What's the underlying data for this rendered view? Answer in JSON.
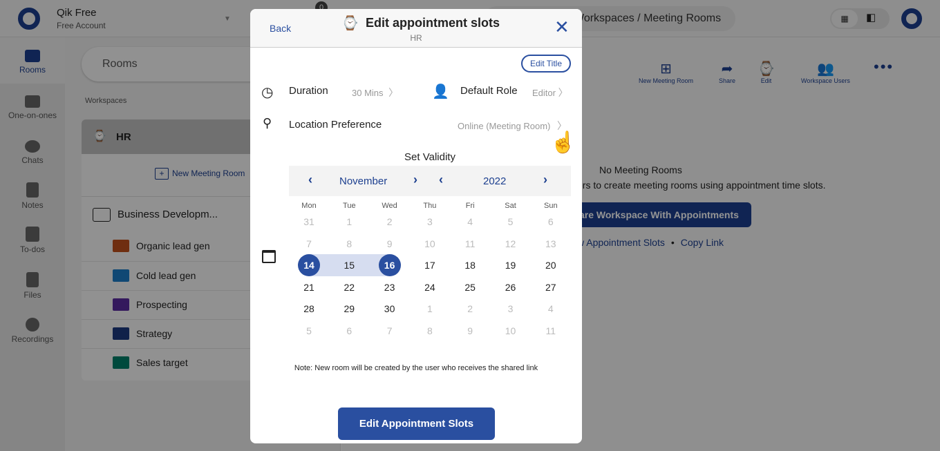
{
  "app": {
    "name": "Qik Free",
    "account": "Free Account",
    "badge": "0"
  },
  "breadcrumb": "Workspaces / Meeting Rooms",
  "sidebar": {
    "items": [
      {
        "label": "Rooms",
        "icon": "rooms-icon",
        "active": true
      },
      {
        "label": "One-on-ones",
        "icon": "people-icon"
      },
      {
        "label": "Chats",
        "icon": "chat-icon"
      },
      {
        "label": "Notes",
        "icon": "notes-icon"
      },
      {
        "label": "To-dos",
        "icon": "todo-icon"
      },
      {
        "label": "Files",
        "icon": "files-icon"
      },
      {
        "label": "Recordings",
        "icon": "recordings-icon"
      }
    ]
  },
  "list": {
    "search": "Rooms",
    "section": "Workspaces",
    "workspace": "HR",
    "new_room": "New Meeting Room",
    "group": "Business Developm...",
    "rooms": [
      {
        "name": "Organic lead gen",
        "color": "#c0501c"
      },
      {
        "name": "Cold lead gen",
        "color": "#1c7cc8"
      },
      {
        "name": "Prospecting",
        "color": "#5a2ca0"
      },
      {
        "name": "Strategy",
        "color": "#1c3a80"
      },
      {
        "name": "Sales target",
        "color": "#00806a"
      }
    ]
  },
  "main": {
    "tools": [
      "New Meeting Room",
      "Share",
      "Edit",
      "Workspace Users"
    ],
    "empty_title": "No Meeting Rooms",
    "empty_text": "ers to create meeting rooms using appointment time slots.",
    "share_button": "are Workspace With Appointments",
    "link1": "w Appointment Slots",
    "link2": "Copy Link"
  },
  "modal": {
    "back": "Back",
    "title": "Edit appointment slots",
    "subtitle": "HR",
    "edit_title": "Edit Title",
    "duration_label": "Duration",
    "duration_value": "30 Mins",
    "role_label": "Default Role",
    "role_value": "Editor",
    "location_label": "Location Preference",
    "location_value": "Online (Meeting Room)",
    "validity": "Set Validity",
    "month": "November",
    "year": "2022",
    "weekdays": [
      "Mon",
      "Tue",
      "Wed",
      "Thu",
      "Fri",
      "Sat",
      "Sun"
    ],
    "weeks": [
      [
        "31",
        "1",
        "2",
        "3",
        "4",
        "5",
        "6"
      ],
      [
        "7",
        "8",
        "9",
        "10",
        "11",
        "12",
        "13"
      ],
      [
        "14",
        "15",
        "16",
        "17",
        "18",
        "19",
        "20"
      ],
      [
        "21",
        "22",
        "23",
        "24",
        "25",
        "26",
        "27"
      ],
      [
        "28",
        "29",
        "30",
        "1",
        "2",
        "3",
        "4"
      ],
      [
        "5",
        "6",
        "7",
        "8",
        "9",
        "10",
        "11"
      ]
    ],
    "disabled_before": "14",
    "range_start": "14",
    "range_end": "16",
    "note": "Note: New room will be created by the user who receives the shared link",
    "submit": "Edit Appointment Slots"
  },
  "colors": {
    "accent": "#2a4fa0"
  }
}
